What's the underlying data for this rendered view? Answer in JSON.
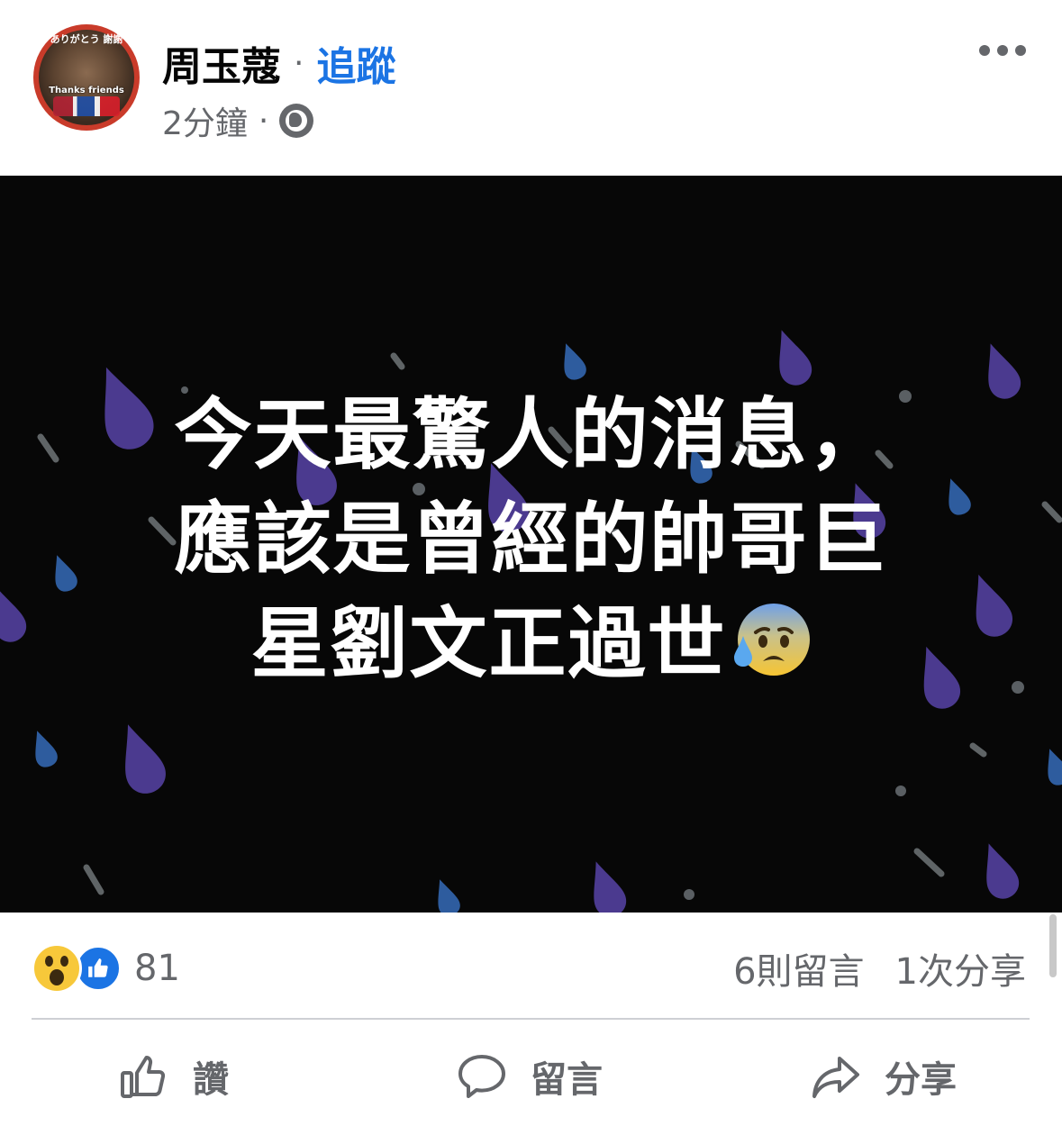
{
  "post": {
    "author": "周玉蔻",
    "separator": "·",
    "follow_label": "追蹤",
    "timestamp": "2分鐘",
    "meta_separator": "·",
    "privacy_icon": "globe-icon",
    "more_icon": "more-options-icon",
    "avatar": {
      "badge_text": "ありがとう 謝謝",
      "caption": "Thanks friends"
    },
    "text_lines": [
      "今天最驚人的消息，",
      "應該是曾經的帥哥巨",
      "星劉文正過世"
    ],
    "text_emoji": "anxious-face-with-sweat-icon"
  },
  "reactions": {
    "icons": [
      "wow-icon",
      "like-icon"
    ],
    "count": "81",
    "comments": "6則留言",
    "shares": "1次分享"
  },
  "actions": {
    "like_label": "讚",
    "comment_label": "留言",
    "share_label": "分享"
  },
  "colors": {
    "accent": "#1b74e4",
    "secondary_text": "#65676b",
    "image_background": "#070707",
    "raindrop_purple": "#4b3a8f",
    "raindrop_blue": "#2e5c9e"
  }
}
